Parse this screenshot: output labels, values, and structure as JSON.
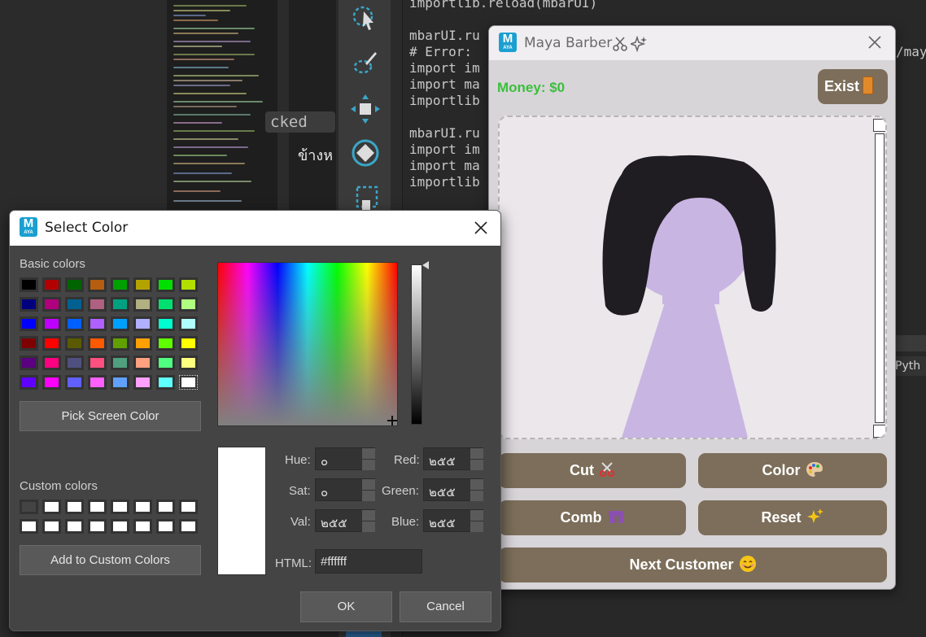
{
  "background": {
    "editor_lines": [
      "importlib.reload(mbarUI)",
      "",
      "mbarUI.ru",
      "# Error:",
      "import im",
      "import ma",
      "importlib",
      "",
      "mbarUI.ru",
      "import im",
      "import ma",
      "importlib"
    ],
    "pill_text": "cked",
    "thai_text": "ข้างห",
    "right_tab_text": "Pyth",
    "right_edge_text": "/may"
  },
  "barber": {
    "title": "Maya Barber",
    "logo_text": "M",
    "logo_sub": "AYA",
    "money": "Money: $0",
    "exist_label": "Exist",
    "buttons": {
      "cut": "Cut",
      "color": "Color",
      "comb": "Comb",
      "reset": "Reset",
      "next": "Next Customer"
    },
    "icons": {
      "title": [
        "scissors-icon",
        "sparkles-icon"
      ],
      "exist": "door-icon",
      "cut": "scissors-icon",
      "color": "palette-icon",
      "comb": "comb-icon",
      "reset": "sparkles-icon",
      "next": "smiley-icon"
    },
    "colors": {
      "button": "#7c6e5a",
      "money": "#3bbf3b",
      "hair": "#1f1c22",
      "skin": "#c8b5e2",
      "canvas": "#ebe7eb"
    }
  },
  "dialog": {
    "title": "Select Color",
    "logo_text": "M",
    "logo_sub": "AYA",
    "basic_colors_label": "Basic colors",
    "basic_colors": [
      [
        "#000000",
        "#b30000",
        "#006400",
        "#b55e10",
        "#00a000",
        "#b3a300",
        "#00e000",
        "#b3e000"
      ],
      [
        "#00007e",
        "#b0007e",
        "#006090",
        "#b06080",
        "#00a080",
        "#b0b080",
        "#00e070",
        "#b0ff80"
      ],
      [
        "#0000ff",
        "#c000ff",
        "#0060ff",
        "#b060ff",
        "#00a0ff",
        "#b0b0ff",
        "#00ffd0",
        "#b0ffff"
      ],
      [
        "#7e0000",
        "#ff0000",
        "#5a5a00",
        "#ff5a00",
        "#60a000",
        "#ffa000",
        "#60ff00",
        "#ffff00"
      ],
      [
        "#5a0080",
        "#ff0080",
        "#505080",
        "#ff5080",
        "#50a080",
        "#ffa080",
        "#50ff80",
        "#ffff80"
      ],
      [
        "#6000ff",
        "#ff00ff",
        "#6060ff",
        "#ff60ff",
        "#60a0ff",
        "#ffa0ff",
        "#60ffff",
        "#ffffff"
      ]
    ],
    "pick_screen_label": "Pick Screen Color",
    "custom_colors_label": "Custom colors",
    "custom_colors": [
      [
        "#444444",
        "#ffffff",
        "#ffffff",
        "#ffffff",
        "#ffffff",
        "#ffffff",
        "#ffffff",
        "#ffffff"
      ],
      [
        "#ffffff",
        "#ffffff",
        "#ffffff",
        "#ffffff",
        "#ffffff",
        "#ffffff",
        "#ffffff",
        "#ffffff"
      ]
    ],
    "add_custom_label": "Add to Custom Colors",
    "fields": {
      "hue_label": "Hue:",
      "hue": "๐",
      "sat_label": "Sat:",
      "sat": "๐",
      "val_label": "Val:",
      "val": "๒๕๕",
      "red_label": "Red:",
      "red": "๒๕๕",
      "green_label": "Green:",
      "green": "๒๕๕",
      "blue_label": "Blue:",
      "blue": "๒๕๕",
      "html_label": "HTML:",
      "html": "#ffffff"
    },
    "current_color": "#ffffff",
    "ok_label": "OK",
    "cancel_label": "Cancel"
  }
}
